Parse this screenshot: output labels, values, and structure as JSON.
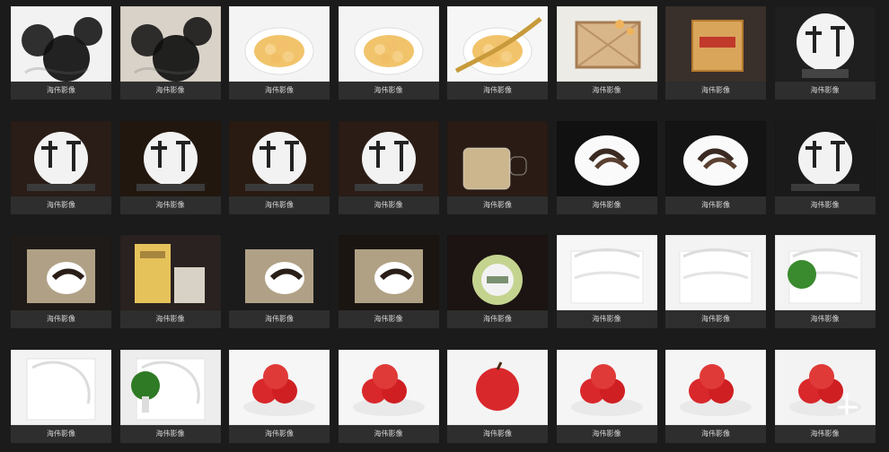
{
  "gallery": {
    "items": [
      {
        "caption": "海伟影像",
        "icon": "black-fungus-photo",
        "bg": "#f2f2f2"
      },
      {
        "caption": "海伟影像",
        "icon": "black-fungus-closeup-photo",
        "bg": "#d9d2c8"
      },
      {
        "caption": "海伟影像",
        "icon": "dessert-bowl-photo",
        "bg": "#f4f4f4"
      },
      {
        "caption": "海伟影像",
        "icon": "dessert-plate-photo",
        "bg": "#f4f4f4"
      },
      {
        "caption": "海伟影像",
        "icon": "spoon-dessert-photo",
        "bg": "#f6f6f6"
      },
      {
        "caption": "海伟影像",
        "icon": "bamboo-tray-photo",
        "bg": "#ecebe6"
      },
      {
        "caption": "海伟影像",
        "icon": "tea-box-photo",
        "bg": "#3a302b"
      },
      {
        "caption": "海伟影像",
        "icon": "tea-cake-on-stand-photo",
        "bg": "#1f1f1f"
      },
      {
        "caption": "海伟影像",
        "icon": "tea-cake-and-package-photo",
        "bg": "#2a1d17"
      },
      {
        "caption": "海伟影像",
        "icon": "tea-cake-photo",
        "bg": "#22170f"
      },
      {
        "caption": "海伟影像",
        "icon": "tea-cake-with-box-photo",
        "bg": "#2a1b12"
      },
      {
        "caption": "海伟影像",
        "icon": "unwrapped-tea-cake-photo",
        "bg": "#2b1c16"
      },
      {
        "caption": "海伟影像",
        "icon": "glass-tea-cup-photo",
        "bg": "#2a1c14"
      },
      {
        "caption": "海伟影像",
        "icon": "tea-leaves-plate-photo",
        "bg": "#111111"
      },
      {
        "caption": "海伟影像",
        "icon": "tea-leaves-plate-2-photo",
        "bg": "#141414"
      },
      {
        "caption": "海伟影像",
        "icon": "tea-cake-and-cup-photo",
        "bg": "#1a1a1a"
      },
      {
        "caption": "海伟影像",
        "icon": "tea-cake-and-cup-2-photo",
        "bg": "#1f1b18"
      },
      {
        "caption": "海伟影像",
        "icon": "tea-boxes-photo",
        "bg": "#2a2220"
      },
      {
        "caption": "海伟影像",
        "icon": "tea-brick-photo",
        "bg": "#1b1b1b"
      },
      {
        "caption": "海伟影像",
        "icon": "tea-brick-closeup-photo",
        "bg": "#1b1512"
      },
      {
        "caption": "海伟影像",
        "icon": "tea-tin-photo",
        "bg": "#1c1412"
      },
      {
        "caption": "海伟影像",
        "icon": "white-shelf-photo",
        "bg": "#f6f6f6"
      },
      {
        "caption": "海伟影像",
        "icon": "white-shelf-2-photo",
        "bg": "#f3f3f3"
      },
      {
        "caption": "海伟影像",
        "icon": "shelf-with-plant-photo",
        "bg": "#f3f3f3"
      },
      {
        "caption": "海伟影像",
        "icon": "carved-screen-photo",
        "bg": "#f3f3f3"
      },
      {
        "caption": "海伟影像",
        "icon": "carved-screen-with-plant-photo",
        "bg": "#ededed"
      },
      {
        "caption": "海伟影像",
        "icon": "apples-in-bowl-photo",
        "bg": "#f6f6f6"
      },
      {
        "caption": "海伟影像",
        "icon": "apples-stack-photo",
        "bg": "#f6f6f6"
      },
      {
        "caption": "海伟影像",
        "icon": "single-apple-photo",
        "bg": "#f4f4f4"
      },
      {
        "caption": "海伟影像",
        "icon": "apple-pyramid-photo",
        "bg": "#f5f5f5"
      },
      {
        "caption": "海伟影像",
        "icon": "apple-pyramid-2-photo",
        "bg": "#f5f5f5"
      },
      {
        "caption": "海伟影像",
        "icon": "apples-with-bicycle-photo",
        "bg": "#f3f3f3"
      }
    ]
  }
}
